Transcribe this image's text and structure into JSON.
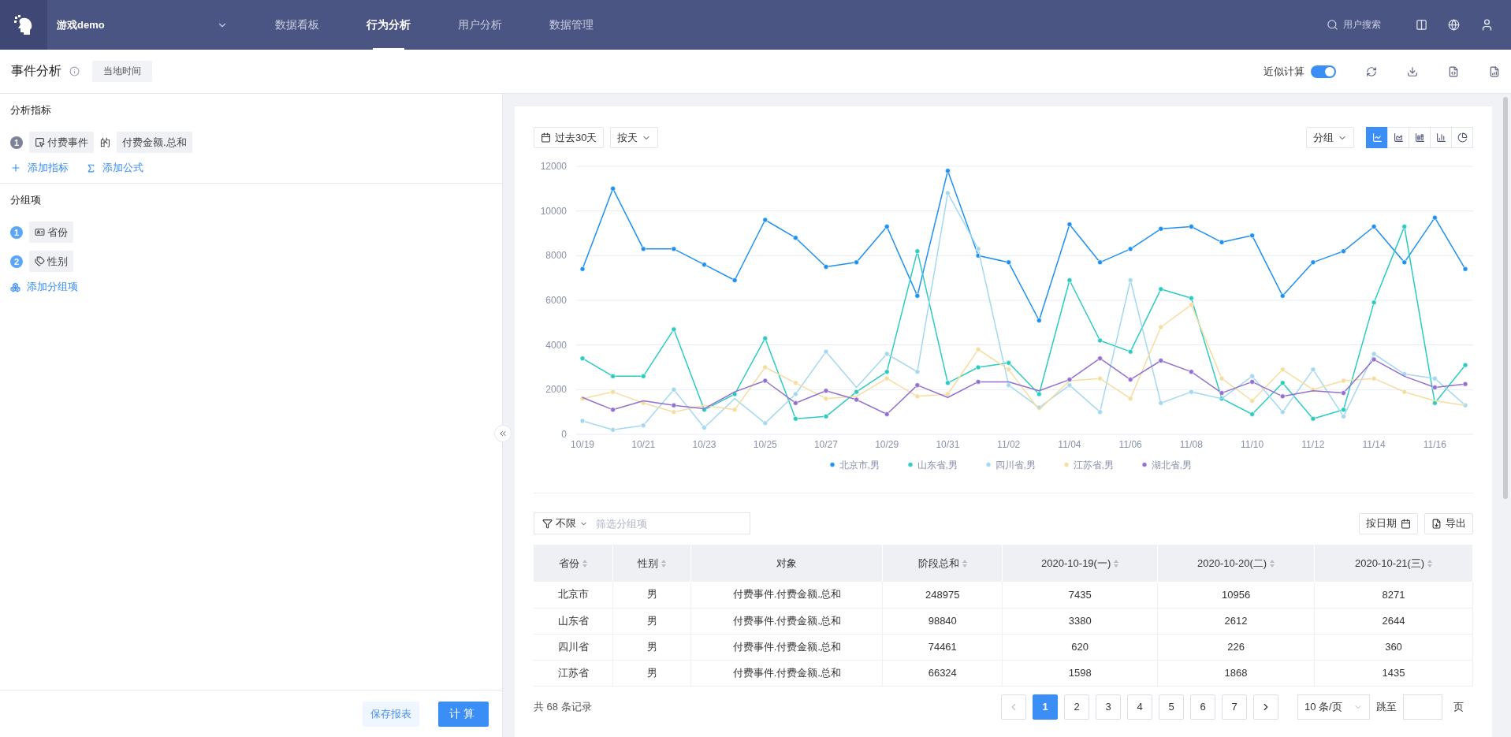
{
  "topbar": {
    "project": "游戏demo",
    "nav": [
      {
        "label": "数据看板",
        "selected": false
      },
      {
        "label": "行为分析",
        "selected": true
      },
      {
        "label": "用户分析",
        "selected": false
      },
      {
        "label": "数据管理",
        "selected": false
      }
    ],
    "search": {
      "placeholder": "用户搜索"
    }
  },
  "header": {
    "title": "事件分析",
    "time_tag": "当地时间",
    "approx": {
      "label": "近似计算",
      "on": true
    }
  },
  "left_panel": {
    "metrics": {
      "title": "分析指标",
      "items": [
        {
          "number": "1",
          "event": "付费事件",
          "connector": "的",
          "property": "付费金额.总和"
        }
      ],
      "actions": [
        {
          "kind": "plus",
          "label": "添加指标"
        },
        {
          "kind": "sigma",
          "label": "添加公式"
        }
      ]
    },
    "groups": {
      "title": "分组项",
      "items": [
        {
          "number": "1",
          "kind": "region",
          "label": "省份"
        },
        {
          "number": "2",
          "kind": "tag",
          "label": "性别"
        }
      ],
      "action": "添加分组项"
    },
    "buttons": {
      "save": "保存报表",
      "run": "计算"
    }
  },
  "chart_toolbar": {
    "range": "过去30天",
    "granularity": "按天",
    "group": "分组",
    "chart_types": [
      {
        "kind": "line",
        "selected": true
      },
      {
        "kind": "area",
        "selected": false
      },
      {
        "kind": "stacked",
        "selected": false
      },
      {
        "kind": "column",
        "selected": false
      },
      {
        "kind": "pie",
        "selected": false
      }
    ]
  },
  "chart": {
    "chart_data": {
      "type": "line",
      "categories": [
        "10/19",
        null,
        "10/21",
        null,
        "10/23",
        null,
        "10/25",
        null,
        "10/27",
        null,
        "10/29",
        null,
        "10/31",
        null,
        "11/02",
        null,
        "11/04",
        null,
        "11/06",
        null,
        "11/08",
        null,
        "11/10",
        null,
        "11/12",
        null,
        "11/14",
        null,
        "11/16",
        null
      ],
      "ylim": [
        0,
        12000
      ],
      "yticks": [
        0,
        2000,
        4000,
        6000,
        8000,
        10000,
        12000
      ],
      "grid": true,
      "legend": true,
      "series": [
        {
          "name": "北京市,男",
          "color": "#1e90f0",
          "marker": "circle",
          "values": [
            7400,
            11000,
            8300,
            8300,
            7600,
            6900,
            9600,
            8800,
            7500,
            7700,
            9300,
            6200,
            11800,
            8000,
            7700,
            5100,
            9400,
            7700,
            8300,
            9200,
            9300,
            8600,
            8900,
            6200,
            7700,
            8200,
            9300,
            7700,
            9700,
            7400
          ]
        },
        {
          "name": "山东省,男",
          "color": "#2ccbbf",
          "marker": "circle",
          "values": [
            3400,
            2600,
            2600,
            4700,
            1100,
            1800,
            4300,
            700,
            800,
            1900,
            2800,
            8200,
            2300,
            3000,
            3200,
            1800,
            6900,
            4200,
            3700,
            6500,
            6100,
            1600,
            900,
            2300,
            700,
            1100,
            5900,
            9300,
            1400,
            3100
          ]
        },
        {
          "name": "四川省,男",
          "color": "#a4d8f0",
          "marker": "circle",
          "values": [
            600,
            200,
            400,
            2000,
            300,
            1600,
            500,
            1800,
            3700,
            2100,
            3600,
            2800,
            10800,
            8300,
            2200,
            1200,
            2200,
            1000,
            6900,
            1400,
            1900,
            1600,
            2600,
            1000,
            2900,
            800,
            3600,
            2700,
            2500,
            1300
          ]
        },
        {
          "name": "江苏省,男",
          "color": "#f5dda0",
          "marker": "circle",
          "values": [
            1600,
            1900,
            1400,
            1000,
            1300,
            1100,
            3000,
            2300,
            1600,
            1700,
            2500,
            1700,
            1800,
            3800,
            2900,
            1100,
            2400,
            2500,
            1600,
            4800,
            5800,
            2500,
            1500,
            2900,
            2000,
            2400,
            2500,
            1900,
            1500,
            1300
          ]
        },
        {
          "name": "湖北省,男",
          "color": "#9370d0",
          "marker": "circle",
          "values": [
            1650,
            1100,
            1500,
            1300,
            1150,
            1900,
            2400,
            1400,
            1950,
            1550,
            900,
            2200,
            1650,
            2350,
            2350,
            1950,
            2450,
            3400,
            2450,
            3300,
            2800,
            1850,
            2350,
            1700,
            1950,
            1850,
            3350,
            2600,
            2100,
            2250
          ]
        }
      ]
    }
  },
  "table_toolbar": {
    "filter": "不限",
    "placeholder": "筛选分组项",
    "by_date": "按日期",
    "export": "导出"
  },
  "table": {
    "columns": [
      {
        "label": "省份",
        "sortable": true
      },
      {
        "label": "性别",
        "sortable": true
      },
      {
        "label": "对象",
        "sortable": false
      },
      {
        "label": "阶段总和",
        "sortable": true
      },
      {
        "label": "2020-10-19(一)",
        "sortable": true
      },
      {
        "label": "2020-10-20(二)",
        "sortable": true
      },
      {
        "label": "2020-10-21(三)",
        "sortable": true
      }
    ],
    "rows": [
      [
        "北京市",
        "男",
        "付费事件.付费金额.总和",
        "248975",
        "7435",
        "10956",
        "8271"
      ],
      [
        "山东省",
        "男",
        "付费事件.付费金额.总和",
        "98840",
        "3380",
        "2612",
        "2644"
      ],
      [
        "四川省",
        "男",
        "付费事件.付费金额.总和",
        "74461",
        "620",
        "226",
        "360"
      ],
      [
        "江苏省",
        "男",
        "付费事件.付费金额.总和",
        "66324",
        "1598",
        "1868",
        "1435"
      ]
    ]
  },
  "pagination": {
    "total": "共 68 条记录",
    "pages": [
      {
        "label": "1",
        "selected": true
      },
      {
        "label": "2",
        "selected": false
      },
      {
        "label": "3",
        "selected": false
      },
      {
        "label": "4",
        "selected": false
      },
      {
        "label": "5",
        "selected": false
      },
      {
        "label": "6",
        "selected": false
      },
      {
        "label": "7",
        "selected": false
      }
    ],
    "page_size": "10 条/页",
    "jump": "跳至",
    "page_suffix": "页"
  }
}
